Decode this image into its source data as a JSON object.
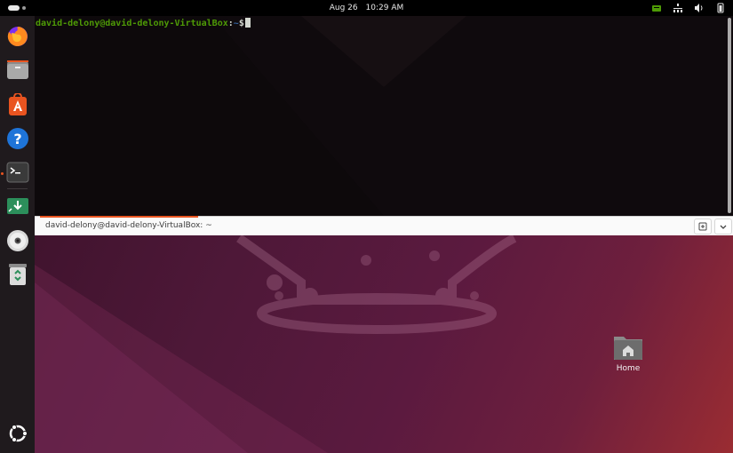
{
  "topbar": {
    "date": "Aug 26",
    "time": "10:29 AM",
    "tray_icons": [
      "keyboard-layout-icon",
      "network-icon",
      "volume-icon",
      "battery-icon"
    ]
  },
  "dock": {
    "items": [
      {
        "name": "firefox",
        "icon": "firefox-icon"
      },
      {
        "name": "files",
        "icon": "files-icon"
      },
      {
        "name": "app-center",
        "icon": "app-center-icon"
      },
      {
        "name": "help",
        "icon": "help-icon"
      },
      {
        "name": "terminal",
        "icon": "terminal-icon",
        "running": true
      },
      {
        "name": "installer",
        "icon": "install-icon"
      },
      {
        "name": "disc",
        "icon": "disc-icon"
      },
      {
        "name": "trash",
        "icon": "trash-icon"
      },
      {
        "name": "show-apps",
        "icon": "ubuntu-logo-icon"
      }
    ]
  },
  "terminal": {
    "prompt_user": "david-delony@david-delony-VirtualBox",
    "prompt_colon": ":",
    "prompt_path": "~",
    "prompt_sign": "$",
    "tab_title": "david-delony@david-delony-VirtualBox: ~",
    "accent_color": "#e95420"
  },
  "desktop": {
    "home_label": "Home"
  },
  "colors": {
    "ubuntu_orange": "#e95420",
    "prompt_green": "#4e9a06",
    "prompt_blue": "#3465a4"
  }
}
